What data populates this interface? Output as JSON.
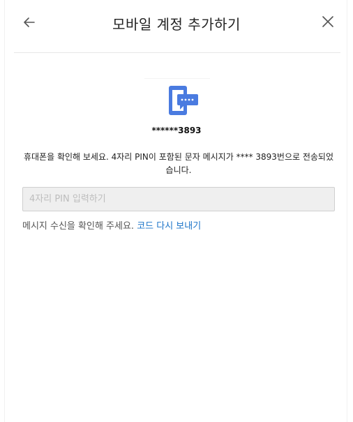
{
  "header": {
    "title": "모바일 계정 추가하기",
    "back_icon": "arrow-left-icon",
    "close_icon": "close-icon"
  },
  "verification": {
    "icon": "phone-message-icon",
    "masked_number": "******3893",
    "instructions": "휴대폰을 확인해 보세요. 4자리 PIN이 포함된 문자 메시지가 **** 3893번으로 전송되었습니다.",
    "pin_placeholder": "4자리 PIN 입력하기",
    "pin_value": "",
    "resend_prompt": "메시지 수신을 확인해 주세요.",
    "resend_link": "코드 다시 보내기"
  },
  "colors": {
    "accent": "#1a73c8",
    "icon_blue": "#4a7be0"
  }
}
